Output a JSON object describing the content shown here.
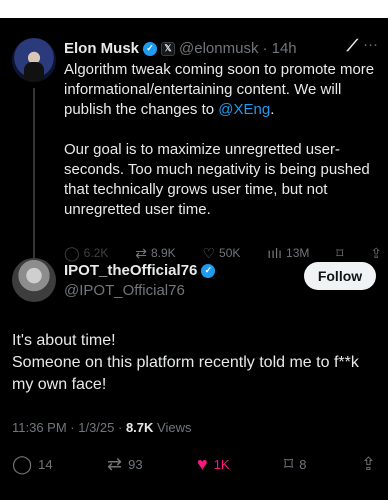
{
  "quoted": {
    "name": "Elon Musk",
    "handle": "@elonmusk",
    "time": "· 14h",
    "paragraph1_pre": "Algorithm tweak coming soon to promote more informational/entertaining content. We will publish the changes to ",
    "paragraph1_link": "@XEng",
    "paragraph1_post": ".",
    "paragraph2": "Our goal is to maximize unregretted user-seconds. Too much negativity is being pushed that technically grows user time, but not unregretted user time.",
    "actions": {
      "replies": "6.2K",
      "reposts": "8.9K",
      "likes": "50K",
      "views": "13M"
    }
  },
  "tweet": {
    "name": "IPOT_theOfficial76",
    "handle": "@IPOT_Official76",
    "follow_label": "Follow",
    "line1": "It's about time!",
    "line2": "Someone on this platform recently told me to f**k my own face!",
    "time": "11:36 PM · 1/3/25 · ",
    "views_count": "8.7K",
    "views_label": " Views",
    "actions": {
      "replies": "14",
      "reposts": "93",
      "likes": "1K",
      "bookmarks": "8"
    }
  },
  "colors": {
    "background": "#000000",
    "accent": "#1d9bf0",
    "like": "#f91880"
  }
}
